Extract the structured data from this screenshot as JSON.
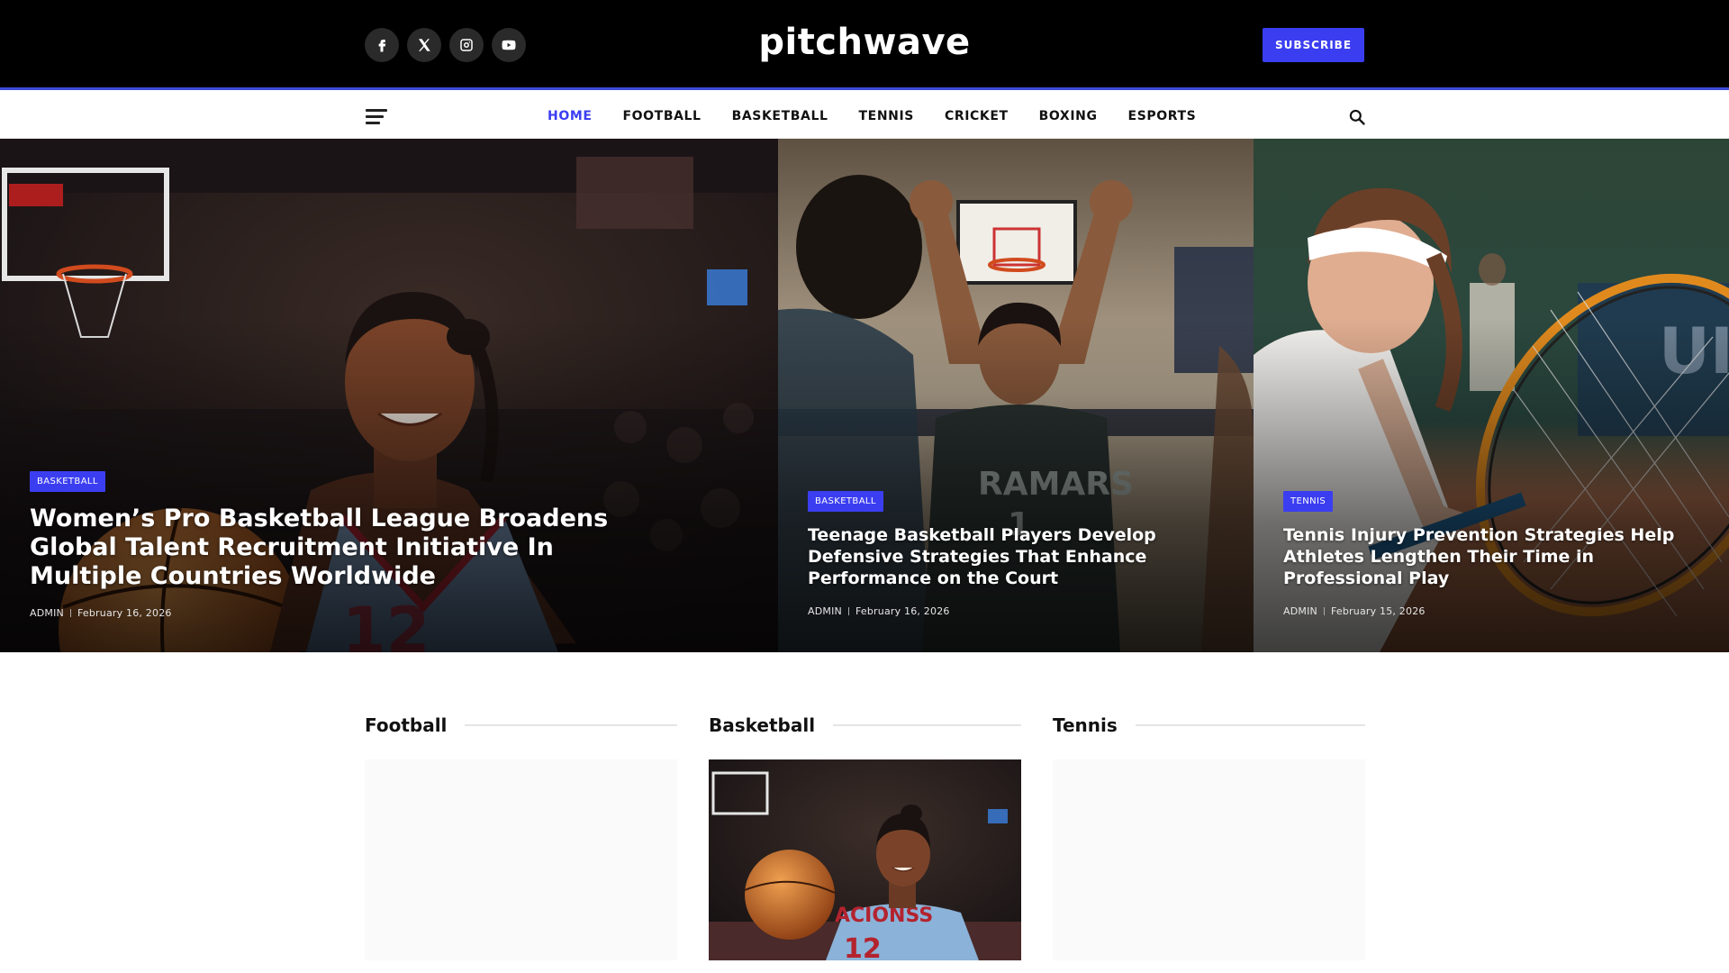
{
  "header": {
    "logo": "pitchwave",
    "subscribe_label": "SUBSCRIBE",
    "social": [
      {
        "name": "facebook-icon"
      },
      {
        "name": "x-icon"
      },
      {
        "name": "instagram-icon"
      },
      {
        "name": "youtube-icon"
      }
    ]
  },
  "nav": {
    "items": [
      {
        "label": "HOME",
        "active": true
      },
      {
        "label": "FOOTBALL"
      },
      {
        "label": "BASKETBALL"
      },
      {
        "label": "TENNIS"
      },
      {
        "label": "CRICKET"
      },
      {
        "label": "BOXING"
      },
      {
        "label": "ESPORTS"
      }
    ]
  },
  "hero": [
    {
      "category": "BASKETBALL",
      "title": "Women’s Pro Basketball League Broadens Global Talent Recruitment Initiative In Multiple Countries Worldwide",
      "author": "ADMIN",
      "date": "February 16, 2026"
    },
    {
      "category": "BASKETBALL",
      "title": "Teenage Basketball Players Develop Defensive Strategies That Enhance Performance on the Court",
      "author": "ADMIN",
      "date": "February 16, 2026"
    },
    {
      "category": "TENNIS",
      "title": "Tennis Injury Prevention Strategies Help Athletes Lengthen Their Time in Professional Play",
      "author": "ADMIN",
      "date": "February 15, 2026"
    }
  ],
  "sections": [
    {
      "title": "Football"
    },
    {
      "title": "Basketball"
    },
    {
      "title": "Tennis"
    }
  ],
  "colors": {
    "accent": "#3b3ef0",
    "header_bg": "#000000"
  }
}
